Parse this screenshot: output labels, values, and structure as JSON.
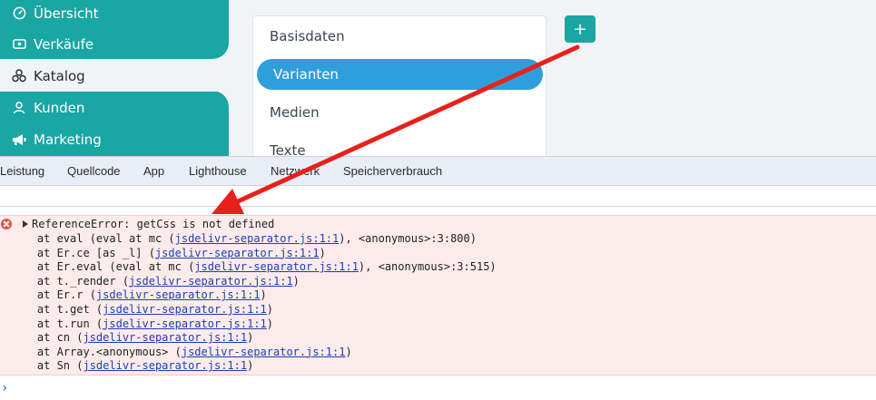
{
  "sidebar": {
    "items": [
      {
        "label": "Übersicht",
        "icon": "dashboard-icon"
      },
      {
        "label": "Verkäufe",
        "icon": "wallet-icon"
      },
      {
        "label": "Katalog",
        "icon": "catalog-icon"
      },
      {
        "label": "Kunden",
        "icon": "user-icon"
      },
      {
        "label": "Marketing",
        "icon": "megaphone-icon"
      }
    ]
  },
  "panel": {
    "tabs": [
      {
        "label": "Basisdaten"
      },
      {
        "label": "Varianten"
      },
      {
        "label": "Medien"
      },
      {
        "label": "Texte"
      }
    ]
  },
  "add_button": {
    "label": "+"
  },
  "devtools": {
    "tabs": [
      "Leistung",
      "Quellcode",
      "App",
      "Lighthouse",
      "Netzwerk",
      "Speicherverbrauch"
    ]
  },
  "console": {
    "error_message": "ReferenceError: getCss is not defined",
    "stack": [
      {
        "pre": "    at eval (eval at mc (",
        "link": "jsdelivr-separator.js:1:1",
        "post": "), <anonymous>:3:800)"
      },
      {
        "pre": "    at Er.ce [as _l] (",
        "link": "jsdelivr-separator.js:1:1",
        "post": ")"
      },
      {
        "pre": "    at Er.eval (eval at mc (",
        "link": "jsdelivr-separator.js:1:1",
        "post": "), <anonymous>:3:515)"
      },
      {
        "pre": "    at t._render (",
        "link": "jsdelivr-separator.js:1:1",
        "post": ")"
      },
      {
        "pre": "    at Er.r (",
        "link": "jsdelivr-separator.js:1:1",
        "post": ")"
      },
      {
        "pre": "    at t.get (",
        "link": "jsdelivr-separator.js:1:1",
        "post": ")"
      },
      {
        "pre": "    at t.run (",
        "link": "jsdelivr-separator.js:1:1",
        "post": ")"
      },
      {
        "pre": "    at cn (",
        "link": "jsdelivr-separator.js:1:1",
        "post": ")"
      },
      {
        "pre": "    at Array.<anonymous> (",
        "link": "jsdelivr-separator.js:1:1",
        "post": ")"
      },
      {
        "pre": "    at Sn (",
        "link": "jsdelivr-separator.js:1:1",
        "post": ")"
      }
    ],
    "prompt": "›"
  },
  "colors": {
    "teal": "#1aa6a3",
    "blue_active": "#2e9fdc",
    "error_bg": "#fcebeb",
    "annotation_arrow": "#e8201c"
  }
}
